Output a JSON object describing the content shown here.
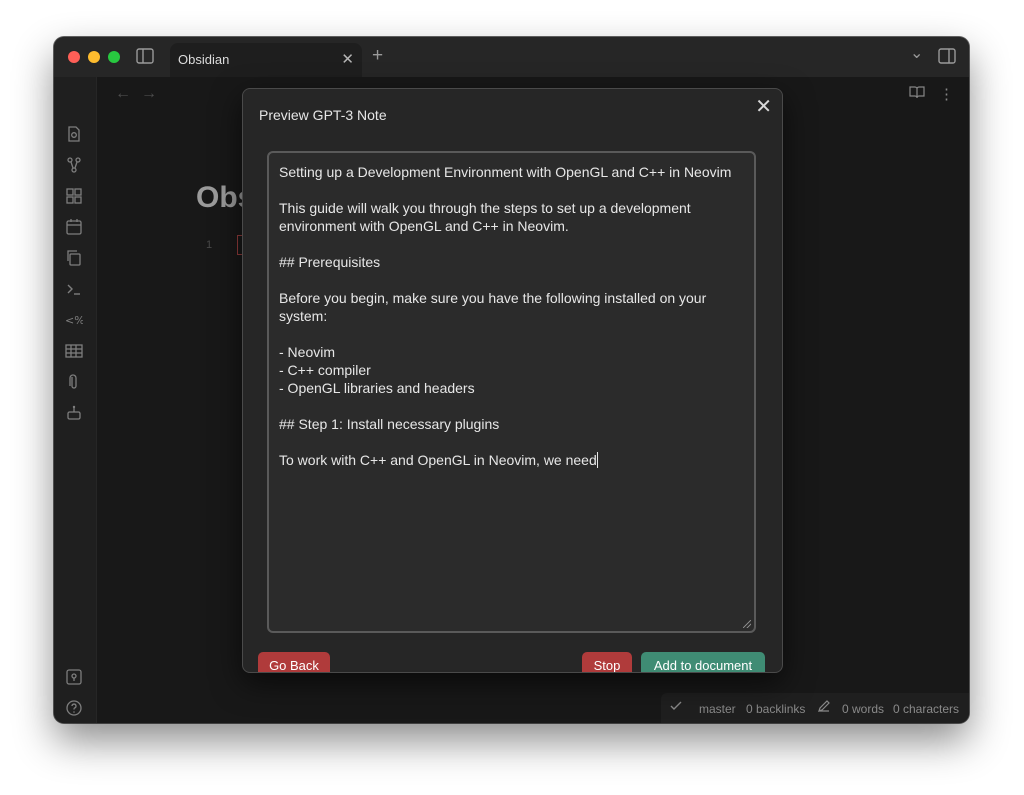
{
  "window": {
    "tab_title": "Obsidian",
    "tab_close": "✕",
    "new_tab": "+",
    "chevron": "⌄"
  },
  "editor": {
    "back_arrow": "←",
    "forward_arrow": "→",
    "note_title": "Obs",
    "line_number": "1",
    "more_icon": "⋮"
  },
  "ribbon": {
    "icons": [
      "file-search-icon",
      "graph-icon",
      "grid-icon",
      "calendar-icon",
      "copy-icon",
      "terminal-icon",
      "templater-icon",
      "table-icon",
      "paperclip-icon",
      "robot-icon",
      "vault-icon",
      "help-icon",
      "settings-icon"
    ]
  },
  "modal": {
    "title": "Preview GPT-3 Note",
    "close": "✕",
    "content": "Setting up a Development Environment with OpenGL and C++ in Neovim\n\nThis guide will walk you through the steps to set up a development environment with OpenGL and C++ in Neovim.\n\n## Prerequisites\n\nBefore you begin, make sure you have the following installed on your system:\n\n- Neovim\n- C++ compiler\n- OpenGL libraries and headers\n\n## Step 1: Install necessary plugins\n\nTo work with C++ and OpenGL in Neovim, we need",
    "buttons": {
      "go_back": "Go Back",
      "stop": "Stop",
      "add": "Add to document"
    }
  },
  "status": {
    "branch": "master",
    "backlinks": "0 backlinks",
    "words": "0 words",
    "characters": "0 characters"
  },
  "colors": {
    "danger": "#b03b3b",
    "accent": "#3f8c74"
  }
}
